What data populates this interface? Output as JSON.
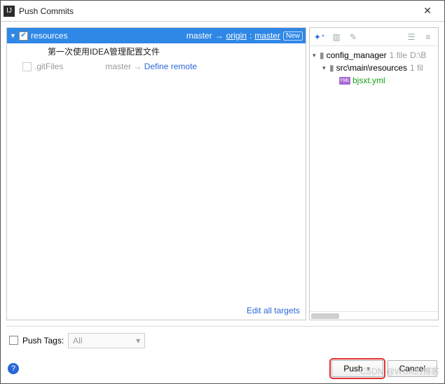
{
  "window": {
    "title": "Push Commits"
  },
  "left": {
    "selected": {
      "name": "resources",
      "local": "master",
      "arrow": "→",
      "remote": "origin",
      "remoteBranch": "master",
      "badge": "New"
    },
    "commit": "第一次使用IDEA管理配置文件",
    "other": {
      "name": ".gitFiles",
      "local": "master",
      "arrow": "→",
      "link": "Define remote"
    },
    "editAll": "Edit all targets"
  },
  "tree": {
    "root": {
      "name": "config_manager",
      "meta": "1 file",
      "path": "D:\\B"
    },
    "sub": {
      "name": "src\\main\\resources",
      "meta": "1 fil"
    },
    "file": {
      "name": "bjsxt.yml",
      "badge": "YML"
    }
  },
  "footer": {
    "pushTags": "Push Tags:",
    "dropdown": "All"
  },
  "buttons": {
    "push": "Push",
    "cancel": "Cancel"
  },
  "watermark": "CSDN @WCK的博客"
}
